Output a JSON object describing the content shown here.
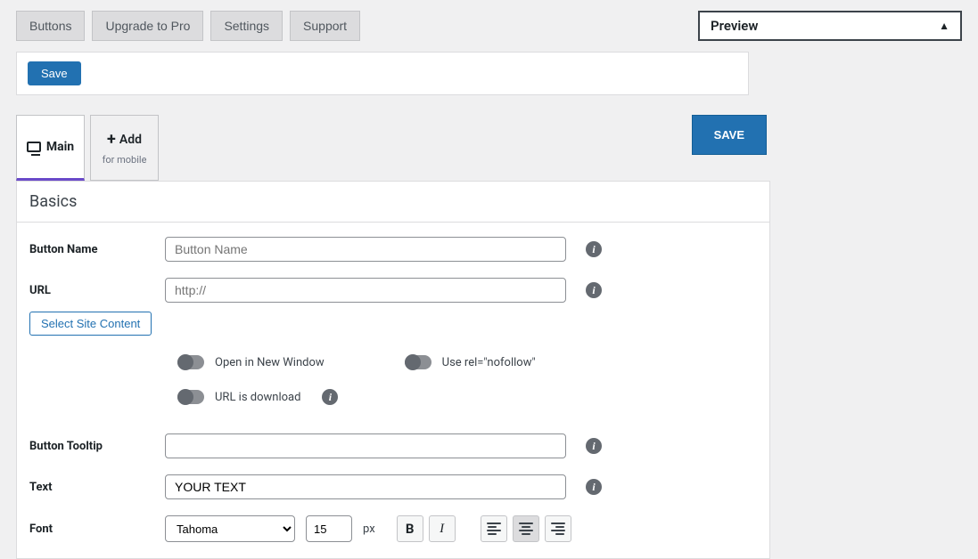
{
  "nav": {
    "buttons": "Buttons",
    "upgrade": "Upgrade to Pro",
    "settings": "Settings",
    "support": "Support"
  },
  "preview": {
    "label": "Preview",
    "triangle": "▲"
  },
  "save_small": "Save",
  "device": {
    "main": "Main",
    "add_top": "Add",
    "add_bot": "for mobile"
  },
  "save_big": "SAVE",
  "panel": {
    "title": "Basics"
  },
  "fields": {
    "button_name_label": "Button Name",
    "button_name_placeholder": "Button Name",
    "url_label": "URL",
    "url_placeholder": "http://",
    "select_site_content": "Select Site Content",
    "open_new_window": "Open in New Window",
    "nofollow": "Use rel=\"nofollow\"",
    "url_download": "URL is download",
    "tooltip_label": "Button Tooltip",
    "text_label": "Text",
    "text_value": "YOUR TEXT",
    "font_label": "Font",
    "font_value": "Tahoma",
    "font_size": "15",
    "font_unit": "px",
    "bold": "B",
    "italic": "I"
  }
}
